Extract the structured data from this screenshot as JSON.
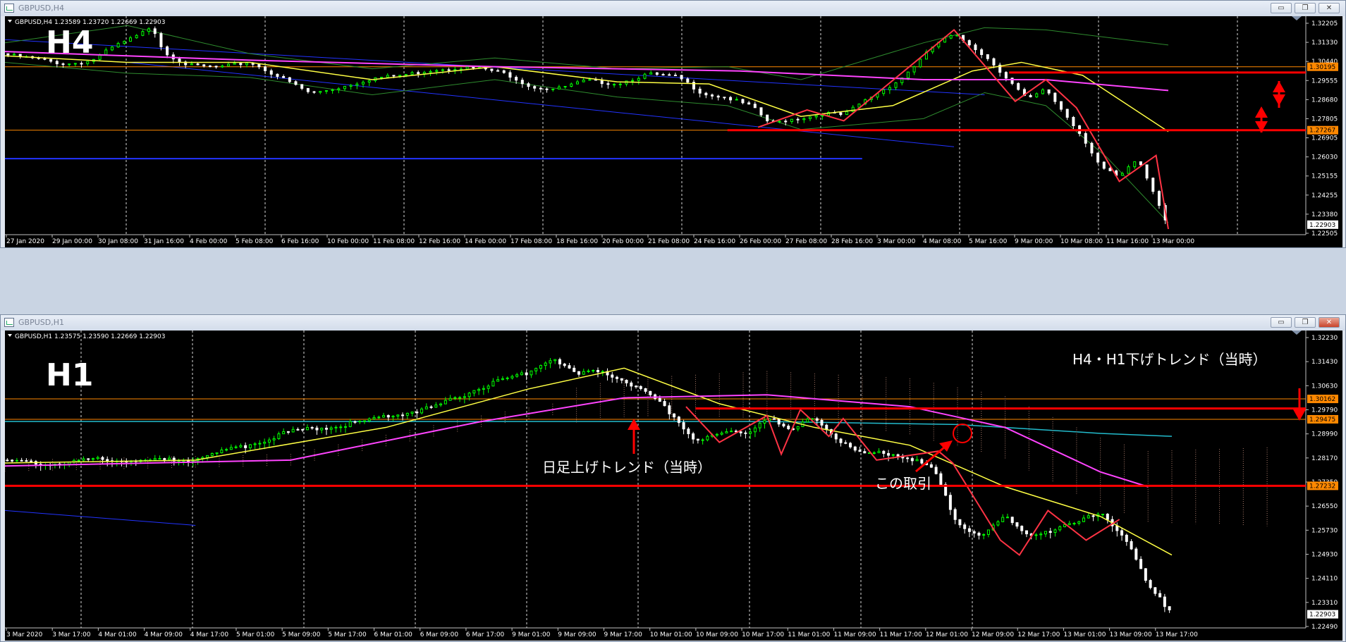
{
  "windows": [
    {
      "title": "GBPUSD,H4",
      "info": "GBPUSD,H4  1.23589 1.23720 1.22669 1.22903",
      "big_label": "H4",
      "buttons": {
        "minimize": "▭",
        "restore": "▭",
        "close": "✕"
      }
    },
    {
      "title": "GBPUSD,H1",
      "info": "GBPUSD,H1  1.23575 1.23590 1.22669 1.22903",
      "big_label": "H1",
      "buttons": {
        "minimize": "▭",
        "restore": "▭",
        "close": "✕"
      }
    }
  ],
  "annotations": {
    "daily_up": "日足上げトレンド（当時）",
    "h4h1_down": "H4・H1下げトレンド（当時）",
    "this_trade": "この取引"
  },
  "colors": {
    "background": "#000000",
    "bull": "#00ff00",
    "bear": "#ffffff",
    "ma_fast": "#ffff44",
    "ma_slow": "#ff44ff",
    "bands": "#2e8b2e",
    "zigzag": "#ff3344",
    "level": "#ff0000",
    "orange_line": "#ff8800",
    "channel": "#2233ff",
    "cyan_line": "#22bbcc"
  },
  "chart_data": [
    {
      "type": "candlestick",
      "symbol": "GBPUSD",
      "timeframe": "H4",
      "ylim": [
        1.22505,
        1.32205
      ],
      "y_ticks": [
        "1.32205",
        "1.31330",
        "1.30440",
        "1.29555",
        "1.28680",
        "1.27805",
        "1.26905",
        "1.26030",
        "1.25155",
        "1.24255",
        "1.23380",
        "1.22505"
      ],
      "x_ticks": [
        "27 Jan 2020",
        "29 Jan 00:00",
        "30 Jan 08:00",
        "31 Jan 16:00",
        "4 Feb 00:00",
        "5 Feb 08:00",
        "6 Feb 16:00",
        "10 Feb 00:00",
        "11 Feb 08:00",
        "12 Feb 16:00",
        "14 Feb 00:00",
        "17 Feb 08:00",
        "18 Feb 16:00",
        "20 Feb 00:00",
        "21 Feb 08:00",
        "24 Feb 16:00",
        "26 Feb 00:00",
        "27 Feb 08:00",
        "28 Feb 16:00",
        "3 Mar 00:00",
        "4 Mar 08:00",
        "5 Mar 16:00",
        "9 Mar 00:00",
        "10 Mar 08:00",
        "11 Mar 16:00",
        "13 Mar 00:00"
      ],
      "price_labels": [
        {
          "value": 1.30195,
          "label": "1.30195",
          "color": "#ff8800"
        },
        {
          "value": 1.27267,
          "label": "1.27267",
          "color": "#ff8800"
        },
        {
          "value": 1.22903,
          "label": "1.22903",
          "color": "#ffffff"
        }
      ],
      "levels": [
        1.2993,
        1.27267
      ],
      "price_path": [
        [
          0,
          1.308
        ],
        [
          5,
          1.306
        ],
        [
          10,
          1.3035
        ],
        [
          14,
          1.305
        ],
        [
          18,
          1.312
        ],
        [
          22,
          1.317
        ],
        [
          24,
          1.3215
        ],
        [
          26,
          1.309
        ],
        [
          30,
          1.303
        ],
        [
          35,
          1.302
        ],
        [
          40,
          1.3045
        ],
        [
          46,
          1.296
        ],
        [
          50,
          1.29
        ],
        [
          55,
          1.293
        ],
        [
          60,
          1.297
        ],
        [
          65,
          1.2985
        ],
        [
          70,
          1.301
        ],
        [
          74,
          1.302
        ],
        [
          78,
          1.3015
        ],
        [
          82,
          1.299
        ],
        [
          86,
          1.293
        ],
        [
          90,
          1.292
        ],
        [
          95,
          1.296
        ],
        [
          100,
          1.2945
        ],
        [
          105,
          1.299
        ],
        [
          110,
          1.2975
        ],
        [
          114,
          1.29
        ],
        [
          118,
          1.288
        ],
        [
          122,
          1.284
        ],
        [
          125,
          1.276
        ],
        [
          128,
          1.278
        ],
        [
          131,
          1.279
        ],
        [
          134,
          1.281
        ],
        [
          137,
          1.28
        ],
        [
          140,
          1.286
        ],
        [
          143,
          1.291
        ],
        [
          146,
          1.296
        ],
        [
          149,
          1.304
        ],
        [
          152,
          1.313
        ],
        [
          155,
          1.317
        ],
        [
          158,
          1.312
        ],
        [
          161,
          1.305
        ],
        [
          164,
          1.296
        ],
        [
          167,
          1.287
        ],
        [
          170,
          1.292
        ],
        [
          173,
          1.281
        ],
        [
          176,
          1.27
        ],
        [
          179,
          1.256
        ],
        [
          182,
          1.251
        ],
        [
          185,
          1.26
        ],
        [
          188,
          1.242
        ],
        [
          190,
          1.229
        ]
      ],
      "ma_fast": [
        [
          0,
          1.307
        ],
        [
          20,
          1.304
        ],
        [
          40,
          1.304
        ],
        [
          60,
          1.296
        ],
        [
          80,
          1.302
        ],
        [
          100,
          1.295
        ],
        [
          115,
          1.294
        ],
        [
          130,
          1.279
        ],
        [
          145,
          1.284
        ],
        [
          158,
          1.3
        ],
        [
          166,
          1.304
        ],
        [
          176,
          1.298
        ],
        [
          190,
          1.272
        ]
      ],
      "ma_slow": [
        [
          0,
          1.309
        ],
        [
          40,
          1.305
        ],
        [
          80,
          1.302
        ],
        [
          120,
          1.3
        ],
        [
          150,
          1.296
        ],
        [
          170,
          1.296
        ],
        [
          190,
          1.291
        ]
      ],
      "band_upper": [
        [
          0,
          1.313
        ],
        [
          20,
          1.321
        ],
        [
          40,
          1.308
        ],
        [
          60,
          1.301
        ],
        [
          80,
          1.306
        ],
        [
          100,
          1.301
        ],
        [
          118,
          1.302
        ],
        [
          130,
          1.296
        ],
        [
          150,
          1.313
        ],
        [
          160,
          1.32
        ],
        [
          170,
          1.319
        ],
        [
          190,
          1.312
        ]
      ],
      "band_lower": [
        [
          0,
          1.304
        ],
        [
          20,
          1.299
        ],
        [
          40,
          1.297
        ],
        [
          60,
          1.289
        ],
        [
          80,
          1.296
        ],
        [
          100,
          1.288
        ],
        [
          118,
          1.284
        ],
        [
          130,
          1.273
        ],
        [
          150,
          1.278
        ],
        [
          160,
          1.29
        ],
        [
          170,
          1.284
        ],
        [
          180,
          1.26
        ],
        [
          190,
          1.23
        ]
      ],
      "zigzag": [
        [
          123,
          1.274
        ],
        [
          131,
          1.282
        ],
        [
          137,
          1.277
        ],
        [
          155,
          1.319
        ],
        [
          165,
          1.286
        ],
        [
          170,
          1.296
        ],
        [
          175,
          1.283
        ],
        [
          182,
          1.249
        ],
        [
          188,
          1.261
        ],
        [
          190,
          1.227
        ]
      ],
      "orange_lines": [
        1.30195,
        1.27267
      ],
      "channel_lines": [
        [
          [
            0,
            1.3145
          ],
          [
            160,
            1.289
          ]
        ],
        [
          [
            20,
            1.304
          ],
          [
            155,
            1.265
          ]
        ],
        [
          [
            0,
            1.2595
          ],
          [
            140,
            1.2595
          ]
        ]
      ]
    },
    {
      "type": "candlestick",
      "symbol": "GBPUSD",
      "timeframe": "H1",
      "ylim": [
        1.2249,
        1.3223
      ],
      "y_ticks": [
        "1.32230",
        "1.31430",
        "1.30630",
        "1.29790",
        "1.28990",
        "1.28170",
        "1.27350",
        "1.26550",
        "1.25730",
        "1.24930",
        "1.24110",
        "1.23310",
        "1.22490"
      ],
      "x_ticks": [
        "3 Mar 2020",
        "3 Mar 17:00",
        "4 Mar 01:00",
        "4 Mar 09:00",
        "4 Mar 17:00",
        "5 Mar 01:00",
        "5 Mar 09:00",
        "5 Mar 17:00",
        "6 Mar 01:00",
        "6 Mar 09:00",
        "6 Mar 17:00",
        "9 Mar 01:00",
        "9 Mar 09:00",
        "9 Mar 17:00",
        "10 Mar 01:00",
        "10 Mar 09:00",
        "10 Mar 17:00",
        "11 Mar 01:00",
        "11 Mar 09:00",
        "11 Mar 17:00",
        "12 Mar 01:00",
        "12 Mar 09:00",
        "12 Mar 17:00",
        "13 Mar 01:00",
        "13 Mar 09:00",
        "13 Mar 17:00"
      ],
      "price_labels": [
        {
          "value": 1.30162,
          "label": "1.30162",
          "color": "#ff8800"
        },
        {
          "value": 1.29475,
          "label": "1.29475",
          "color": "#ff8800"
        },
        {
          "value": 1.27232,
          "label": "1.27232",
          "color": "#ff8800"
        },
        {
          "value": 1.22903,
          "label": "1.22903",
          "color": "#ffffff"
        }
      ],
      "levels": [
        1.2984,
        1.27232
      ],
      "price_path": [
        [
          0,
          1.281
        ],
        [
          10,
          1.28
        ],
        [
          20,
          1.282
        ],
        [
          30,
          1.281
        ],
        [
          40,
          1.282
        ],
        [
          50,
          1.286
        ],
        [
          60,
          1.291
        ],
        [
          70,
          1.293
        ],
        [
          80,
          1.296
        ],
        [
          90,
          1.299
        ],
        [
          100,
          1.306
        ],
        [
          110,
          1.311
        ],
        [
          115,
          1.316
        ],
        [
          120,
          1.31
        ],
        [
          125,
          1.312
        ],
        [
          130,
          1.308
        ],
        [
          135,
          1.304
        ],
        [
          140,
          1.297
        ],
        [
          145,
          1.288
        ],
        [
          150,
          1.29
        ],
        [
          156,
          1.291
        ],
        [
          160,
          1.296
        ],
        [
          165,
          1.291
        ],
        [
          170,
          1.296
        ],
        [
          175,
          1.288
        ],
        [
          180,
          1.283
        ],
        [
          185,
          1.284
        ],
        [
          190,
          1.282
        ],
        [
          195,
          1.278
        ],
        [
          200,
          1.26
        ],
        [
          205,
          1.256
        ],
        [
          210,
          1.262
        ],
        [
          215,
          1.256
        ],
        [
          220,
          1.258
        ],
        [
          225,
          1.26
        ],
        [
          230,
          1.264
        ],
        [
          235,
          1.256
        ],
        [
          240,
          1.239
        ],
        [
          245,
          1.23
        ]
      ],
      "ma_fast": [
        [
          0,
          1.28
        ],
        [
          40,
          1.281
        ],
        [
          80,
          1.292
        ],
        [
          110,
          1.305
        ],
        [
          130,
          1.312
        ],
        [
          150,
          1.3
        ],
        [
          170,
          1.292
        ],
        [
          190,
          1.286
        ],
        [
          210,
          1.272
        ],
        [
          230,
          1.262
        ],
        [
          245,
          1.249
        ]
      ],
      "ma_slow": [
        [
          0,
          1.279
        ],
        [
          60,
          1.281
        ],
        [
          100,
          1.294
        ],
        [
          130,
          1.302
        ],
        [
          160,
          1.303
        ],
        [
          190,
          1.299
        ],
        [
          210,
          1.292
        ],
        [
          230,
          1.277
        ],
        [
          240,
          1.272
        ]
      ],
      "cyan_line": [
        [
          0,
          1.294
        ],
        [
          120,
          1.294
        ],
        [
          160,
          1.294
        ],
        [
          200,
          1.293
        ],
        [
          230,
          1.29
        ],
        [
          245,
          1.289
        ]
      ],
      "zigzag": [
        [
          143,
          1.299
        ],
        [
          150,
          1.287
        ],
        [
          160,
          1.296
        ],
        [
          163,
          1.283
        ],
        [
          167,
          1.298
        ],
        [
          173,
          1.289
        ],
        [
          176,
          1.295
        ],
        [
          183,
          1.281
        ],
        [
          196,
          1.284
        ],
        [
          199,
          1.28
        ],
        [
          209,
          1.254
        ],
        [
          213,
          1.249
        ],
        [
          219,
          1.264
        ],
        [
          227,
          1.254
        ],
        [
          234,
          1.261
        ]
      ],
      "orange_lines": [
        1.30162,
        1.29475
      ],
      "blue_line": [
        [
          0,
          1.264
        ],
        [
          40,
          1.259
        ]
      ]
    }
  ]
}
